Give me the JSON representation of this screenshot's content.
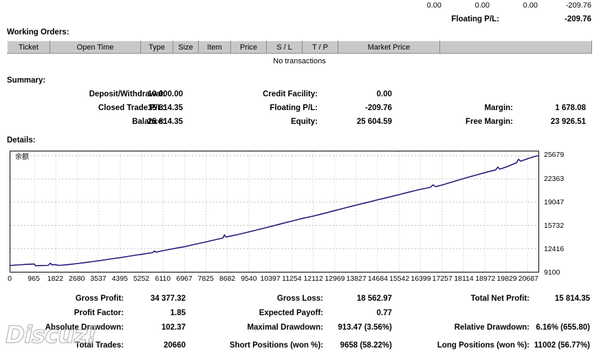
{
  "top_row": {
    "values": [
      "0.00",
      "0.00",
      "0.00",
      "-209.76"
    ],
    "floating_pl_label": "Floating P/L:",
    "floating_pl_value": "-209.76"
  },
  "working_orders": {
    "title": "Working Orders:",
    "columns": [
      "Ticket",
      "Open Time",
      "Type",
      "Size",
      "Item",
      "Price",
      "S / L",
      "T / P",
      "Market Price",
      ""
    ],
    "empty_message": "No transactions"
  },
  "summary": {
    "title": "Summary:",
    "rows": [
      {
        "col1_label": "Deposit/Withdrawal:",
        "col1_value": "10 000.00",
        "col2_label": "Credit Facility:",
        "col2_value": "0.00",
        "col3_label": "",
        "col3_value": ""
      },
      {
        "col1_label": "Closed Trade P/L:",
        "col1_value": "15 814.35",
        "col2_label": "Floating P/L:",
        "col2_value": "-209.76",
        "col3_label": "Margin:",
        "col3_value": "1 678.08"
      },
      {
        "col1_label": "Balance:",
        "col1_value": "25 814.35",
        "col2_label": "Equity:",
        "col2_value": "25 604.59",
        "col3_label": "Free Margin:",
        "col3_value": "23 926.51"
      }
    ]
  },
  "details": {
    "title": "Details:"
  },
  "chart_data": {
    "type": "line",
    "title": "",
    "legend": [
      "余额"
    ],
    "legend_position": "top-left",
    "xlabel": "",
    "ylabel": "",
    "grid": true,
    "line_color": "#201a7a",
    "xlim": [
      0,
      21116
    ],
    "ylim": [
      9100,
      26300
    ],
    "xticks": [
      0,
      965,
      1822,
      2680,
      3537,
      4395,
      5252,
      6110,
      6967,
      7825,
      8682,
      9540,
      10397,
      11254,
      12112,
      12969,
      13827,
      14684,
      15542,
      16399,
      17257,
      18114,
      18972,
      19829,
      20687
    ],
    "yticks": [
      9100,
      12416,
      15732,
      19047,
      22363,
      25679
    ],
    "series": [
      {
        "name": "余额",
        "x": [
          0,
          200,
          420,
          640,
          800,
          900,
          960,
          1010,
          1060,
          1200,
          1380,
          1520,
          1600,
          1660,
          1700,
          1760,
          1830,
          1900,
          2000,
          2100,
          2200,
          2400,
          2680,
          3000,
          3300,
          3537,
          3800,
          4100,
          4395,
          4700,
          5000,
          5252,
          5500,
          5700,
          5760,
          5820,
          5900,
          6110,
          6400,
          6700,
          6967,
          7200,
          7500,
          7825,
          8000,
          8200,
          8400,
          8500,
          8560,
          8620,
          8700,
          8900,
          9100,
          9540,
          9900,
          10397,
          10700,
          11000,
          11254,
          11600,
          12112,
          12500,
          12969,
          13300,
          13600,
          13827,
          14100,
          14400,
          14684,
          14900,
          15200,
          15542,
          15800,
          16100,
          16399,
          16600,
          16800,
          16900,
          17000,
          17257,
          17600,
          18000,
          18114,
          18400,
          18700,
          18972,
          19200,
          19400,
          19500,
          19560,
          19650,
          19829,
          20000,
          20150,
          20250,
          20320,
          20400,
          20500,
          20687,
          20900,
          21116
        ],
        "y": [
          10000,
          10060,
          10110,
          10160,
          10190,
          10210,
          10200,
          9960,
          9965,
          9990,
          10010,
          10020,
          10340,
          10100,
          10105,
          10110,
          10120,
          10030,
          10040,
          10060,
          10090,
          10160,
          10280,
          10420,
          10560,
          10680,
          10820,
          10980,
          11120,
          11300,
          11470,
          11600,
          11740,
          11850,
          12080,
          11900,
          11960,
          12120,
          12320,
          12520,
          12680,
          12880,
          13120,
          13360,
          13520,
          13680,
          13840,
          13920,
          14380,
          14060,
          14120,
          14280,
          14420,
          14800,
          15120,
          15560,
          15840,
          16120,
          16340,
          16660,
          17060,
          17400,
          17840,
          18140,
          18420,
          18620,
          18860,
          19120,
          19380,
          19560,
          19820,
          20120,
          20360,
          20620,
          20880,
          21020,
          21180,
          21520,
          21260,
          21480,
          21860,
          22280,
          22400,
          22700,
          23000,
          23260,
          23480,
          23640,
          24060,
          23760,
          23850,
          24080,
          24320,
          24540,
          24700,
          25180,
          24900,
          25020,
          25260,
          25500,
          25700
        ]
      }
    ]
  },
  "statistics": {
    "rows": [
      {
        "c1_label": "Gross Profit:",
        "c1_value": "34 377.32",
        "c2_label": "Gross Loss:",
        "c2_value": "18 562.97",
        "c3_label": "Total Net Profit:",
        "c3_value": "15 814.35"
      },
      {
        "c1_label": "Profit Factor:",
        "c1_value": "1.85",
        "c2_label": "Expected Payoff:",
        "c2_value": "0.77",
        "c3_label": "",
        "c3_value": ""
      },
      {
        "c1_label": "Absolute Drawdown:",
        "c1_value": "102.37",
        "c2_label": "Maximal Drawdown:",
        "c2_value": "913.47 (3.56%)",
        "c3_label": "Relative Drawdown:",
        "c3_value": "6.16% (655.80)"
      },
      {
        "c1_label": "Total Trades:",
        "c1_value": "20660",
        "c2_label": "Short Positions (won %):",
        "c2_value": "9658 (58.22%)",
        "c3_label": "Long Positions (won %):",
        "c3_value": "11002 (56.77%)"
      }
    ]
  },
  "watermark": {
    "text": "Discuz!"
  }
}
